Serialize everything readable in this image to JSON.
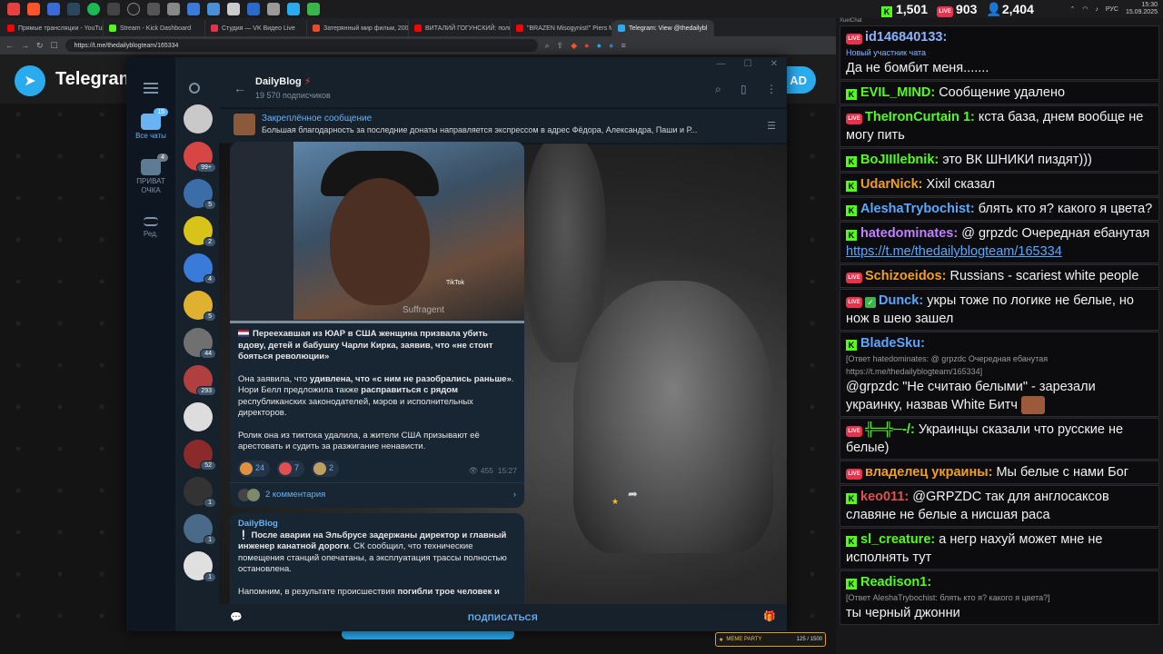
{
  "taskbar": {
    "time": "15:30",
    "date": "15.09.2025",
    "lang": "РУС"
  },
  "browser": {
    "tabs": [
      {
        "title": "Прямые трансляции - YouTube S",
        "color": "#ff0000"
      },
      {
        "title": "Stream - Kick Dashboard",
        "color": "#53fc18"
      },
      {
        "title": "Студия — VK Видео Live",
        "color": "#e8324b"
      },
      {
        "title": "Затерянный мир фильм, 2009, д",
        "color": "#e84a2a"
      },
      {
        "title": "ВИТАЛИЙ ГОГУНСКИЙ: полигр",
        "color": "#ff0000"
      },
      {
        "title": "\"BRAZEN Misogynist!\" Piers Morg",
        "color": "#ff0000"
      },
      {
        "title": "Telegram: View @thedailybl",
        "color": "#2aabee"
      }
    ],
    "url": "https://t.me/thedailyblogteam/165334"
  },
  "tgpage": {
    "brand": "Telegram",
    "button_label": "AD"
  },
  "telegram": {
    "folders": [
      {
        "label": "Все чаты",
        "badge": "15",
        "active": true
      },
      {
        "label": "ПРИВАТ ОЧКА",
        "badge": "4",
        "active": false
      },
      {
        "label": "Ред.",
        "badge": "",
        "active": false
      }
    ],
    "chat_avatars": [
      {
        "badge": "",
        "color": "#c9c9c9"
      },
      {
        "badge": "99+",
        "color": "#d84545"
      },
      {
        "badge": "5",
        "color": "#3b6ea8"
      },
      {
        "badge": "2",
        "color": "#d8c419"
      },
      {
        "badge": "4",
        "color": "#3a7ad8"
      },
      {
        "badge": "5",
        "color": "#e0b030"
      },
      {
        "badge": "44",
        "color": "#707070"
      },
      {
        "badge": "293",
        "color": "#b04040"
      },
      {
        "badge": "",
        "color": "#dddddd"
      },
      {
        "badge": "52",
        "color": "#8a2a2a"
      },
      {
        "badge": "1",
        "color": "#333333"
      },
      {
        "badge": "1",
        "color": "#4a6a8a"
      },
      {
        "badge": "1",
        "color": "#e0e0e0"
      }
    ],
    "channel": {
      "name": "DailyBlog",
      "subscribers": "19 570 подписчиков"
    },
    "pinned": {
      "title": "Закреплённое сообщение",
      "text": "Большая благодарность за последние донаты направляется экспрессом в адрес Фёдора, Александра, Паши и Р..."
    },
    "post1": {
      "video_watermark": "Suffragent",
      "video_tiktok": "TikTok",
      "p1": "Переехавшая из ЮАР в США женщина призвала убить вдову, детей и бабушку Чарли Кирка, заявив, что «не стоит бояться революции»",
      "p2_a": "Она заявила, что ",
      "p2_b": "удивлена, что «с ним не разобрались раньше»",
      "p2_c": ". Нори Белл предложила также ",
      "p2_d": "расправиться с рядом",
      "p2_e": " республиканских законодателей, мэров и исполнительных директоров.",
      "p3": "Ролик она из тиктока удалила, а жители США призывают её арестовать и судить за разжигание ненависти.",
      "reactions": [
        {
          "count": "24",
          "color": "#e09040"
        },
        {
          "count": "7",
          "color": "#e05050"
        },
        {
          "count": "2",
          "color": "#c0a060"
        }
      ],
      "views": "455",
      "time": "15:27",
      "comments": "2 комментария"
    },
    "post2": {
      "channel": "DailyBlog",
      "p1_a": "После аварии на Эльбрусе задержаны директор и главный инженер канатной дороги",
      "p1_b": ". СК сообщил, что технические помещения станций опечатаны, а эксплуатация трассы полностью остановлена.",
      "p2_a": "Напомним, в результате происшествия ",
      "p2_b": "погибли трое человек и"
    },
    "subscribe_label": "ПОДПИСАТЬСЯ"
  },
  "memebar": {
    "title": "MEME PARTY",
    "progress": "125 / 1500"
  },
  "stream_chat": {
    "header": "XuelChat",
    "stats": {
      "kick": "1,501",
      "vk": "903",
      "total": "2,404"
    },
    "messages": [
      {
        "platform": "vk",
        "user": "id146840133",
        "color": "#8ab4ff",
        "reply": "Новый участник чата",
        "text": "Да не бомбит меня......."
      },
      {
        "platform": "kick",
        "user": "EVIL_MIND",
        "color": "#53fc18",
        "text": "Сообщение удалено"
      },
      {
        "platform": "vk",
        "user": "TheIronCurtain 1",
        "color": "#53fc18",
        "text": "кста база, днем вообще не могу пить"
      },
      {
        "platform": "kick",
        "user": "BoJIIIlebnik",
        "color": "#53fc18",
        "text": "это ВК ШНИКИ пиздят)))"
      },
      {
        "platform": "kick",
        "user": "UdarNick",
        "color": "#f0a020",
        "text": "Xixil сказал"
      },
      {
        "platform": "kick",
        "user": "AleshaTrybochist",
        "color": "#5aa7ff",
        "text": "блять кто я? какого я цвета?"
      },
      {
        "platform": "kick",
        "user": "hatedominates",
        "color": "#c080ff",
        "text": "@ grpzdc Очередная ебанутая",
        "link": "https://t.me/thedailyblogteam/165334"
      },
      {
        "platform": "vk",
        "user": "Schizoeidos",
        "color": "#f0a020",
        "text": "Russians - scariest white people"
      },
      {
        "platform": "vkcheck",
        "user": "Dunck",
        "color": "#5aa7ff",
        "text": "укры тоже по логике не белые, но нож в шею зашел"
      },
      {
        "platform": "kick",
        "user": "BladeSku",
        "color": "#5aa7ff",
        "reply": "[Ответ hatedominates: @ grpzdc Очередная ебанутая https://t.me/thedailyblogteam/165334]",
        "text": "@grpzdc \"Не считаю белыми\" - зарезали украинку, назвав White Битч",
        "emote": true
      },
      {
        "platform": "vk",
        "user": "╬═╬─-/",
        "color": "#53fc18",
        "text": "Украинцы сказали что русские не белые)"
      },
      {
        "platform": "vk",
        "user": "владелец украины",
        "color": "#f0a020",
        "text": "Мы белые с нами Бог"
      },
      {
        "platform": "kick",
        "user": "keo011",
        "color": "#e05050",
        "text": "@GRPZDC так для англосаксов славяне не белые а нисшая раса"
      },
      {
        "platform": "kick",
        "user": "sl_creature",
        "color": "#53fc18",
        "text": "а негр нахуй может мне не исполнять тут"
      },
      {
        "platform": "kick",
        "user": "Readison1",
        "color": "#53fc18",
        "reply": "[Ответ AleshaTrybochist: блять кто я? какого я цвета?]",
        "text": "ты черный джонни"
      }
    ]
  }
}
